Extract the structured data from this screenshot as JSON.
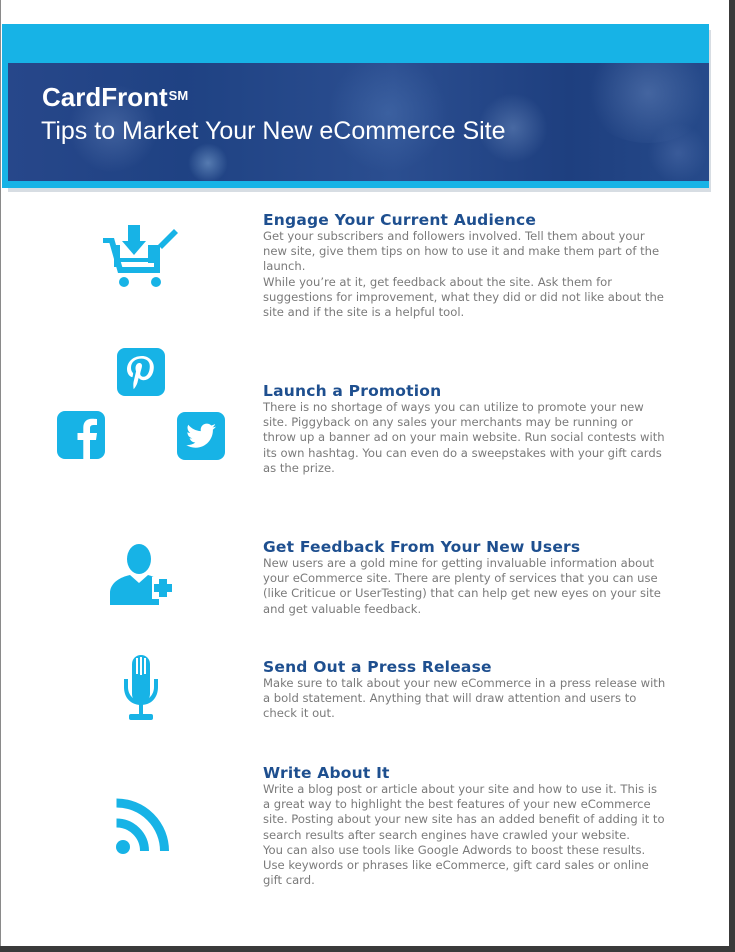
{
  "header": {
    "brand": "CardFront",
    "brand_mark": "SM",
    "subtitle": "Tips to Market Your New eCommerce Site"
  },
  "tips": [
    {
      "heading": "Engage Your Current Audience",
      "icon": "shopping-cart-download-icon",
      "lines": [
        "Get your subscribers and followers involved. Tell them about your",
        "new site, give them tips on how to use it and make them part of the",
        "launch.",
        "While you’re at it, get feedback about the site. Ask them for",
        "suggestions for improvement, what they did or did not like about the",
        "site and if the site is a helpful tool."
      ]
    },
    {
      "heading": "Launch a Promotion",
      "icon": "social-media-icons",
      "lines": [
        "There is no shortage of ways you can utilize to promote your new",
        "site. Piggyback on any sales your merchants may be running or",
        "throw up a banner ad on your main website. Run social contests with",
        "its own hashtag. You can even do a sweepstakes with your gift cards",
        "as the prize."
      ]
    },
    {
      "heading": "Get Feedback From Your New Users",
      "icon": "add-user-icon",
      "lines": [
        "New users are a gold mine for getting invaluable information about",
        "your eCommerce site. There are plenty of services that you can use",
        "(like Criticue or UserTesting) that can help get new eyes on your site",
        "and get valuable feedback."
      ]
    },
    {
      "heading": "Send Out a Press Release",
      "icon": "microphone-icon",
      "lines": [
        "Make sure to talk about your new eCommerce in a press release with",
        "a bold statement. Anything that will draw attention and users to",
        "check it out."
      ]
    },
    {
      "heading": "Write About It",
      "icon": "rss-feed-icon",
      "lines": [
        "Write a blog post or article about your site and how to use it. This is",
        "a great way to highlight the best features of your new eCommerce",
        "site. Posting about your new site has an added benefit of adding it to",
        "search results after search engines have crawled your website.",
        "You can also use tools like Google Adwords to boost these results.",
        "Use keywords or phrases like eCommerce, gift card sales or online",
        "gift card."
      ]
    }
  ],
  "colors": {
    "accent": "#17b3e6",
    "heading": "#1e4f8f",
    "body_text": "#7a7a7a",
    "banner": "#264a8a"
  }
}
